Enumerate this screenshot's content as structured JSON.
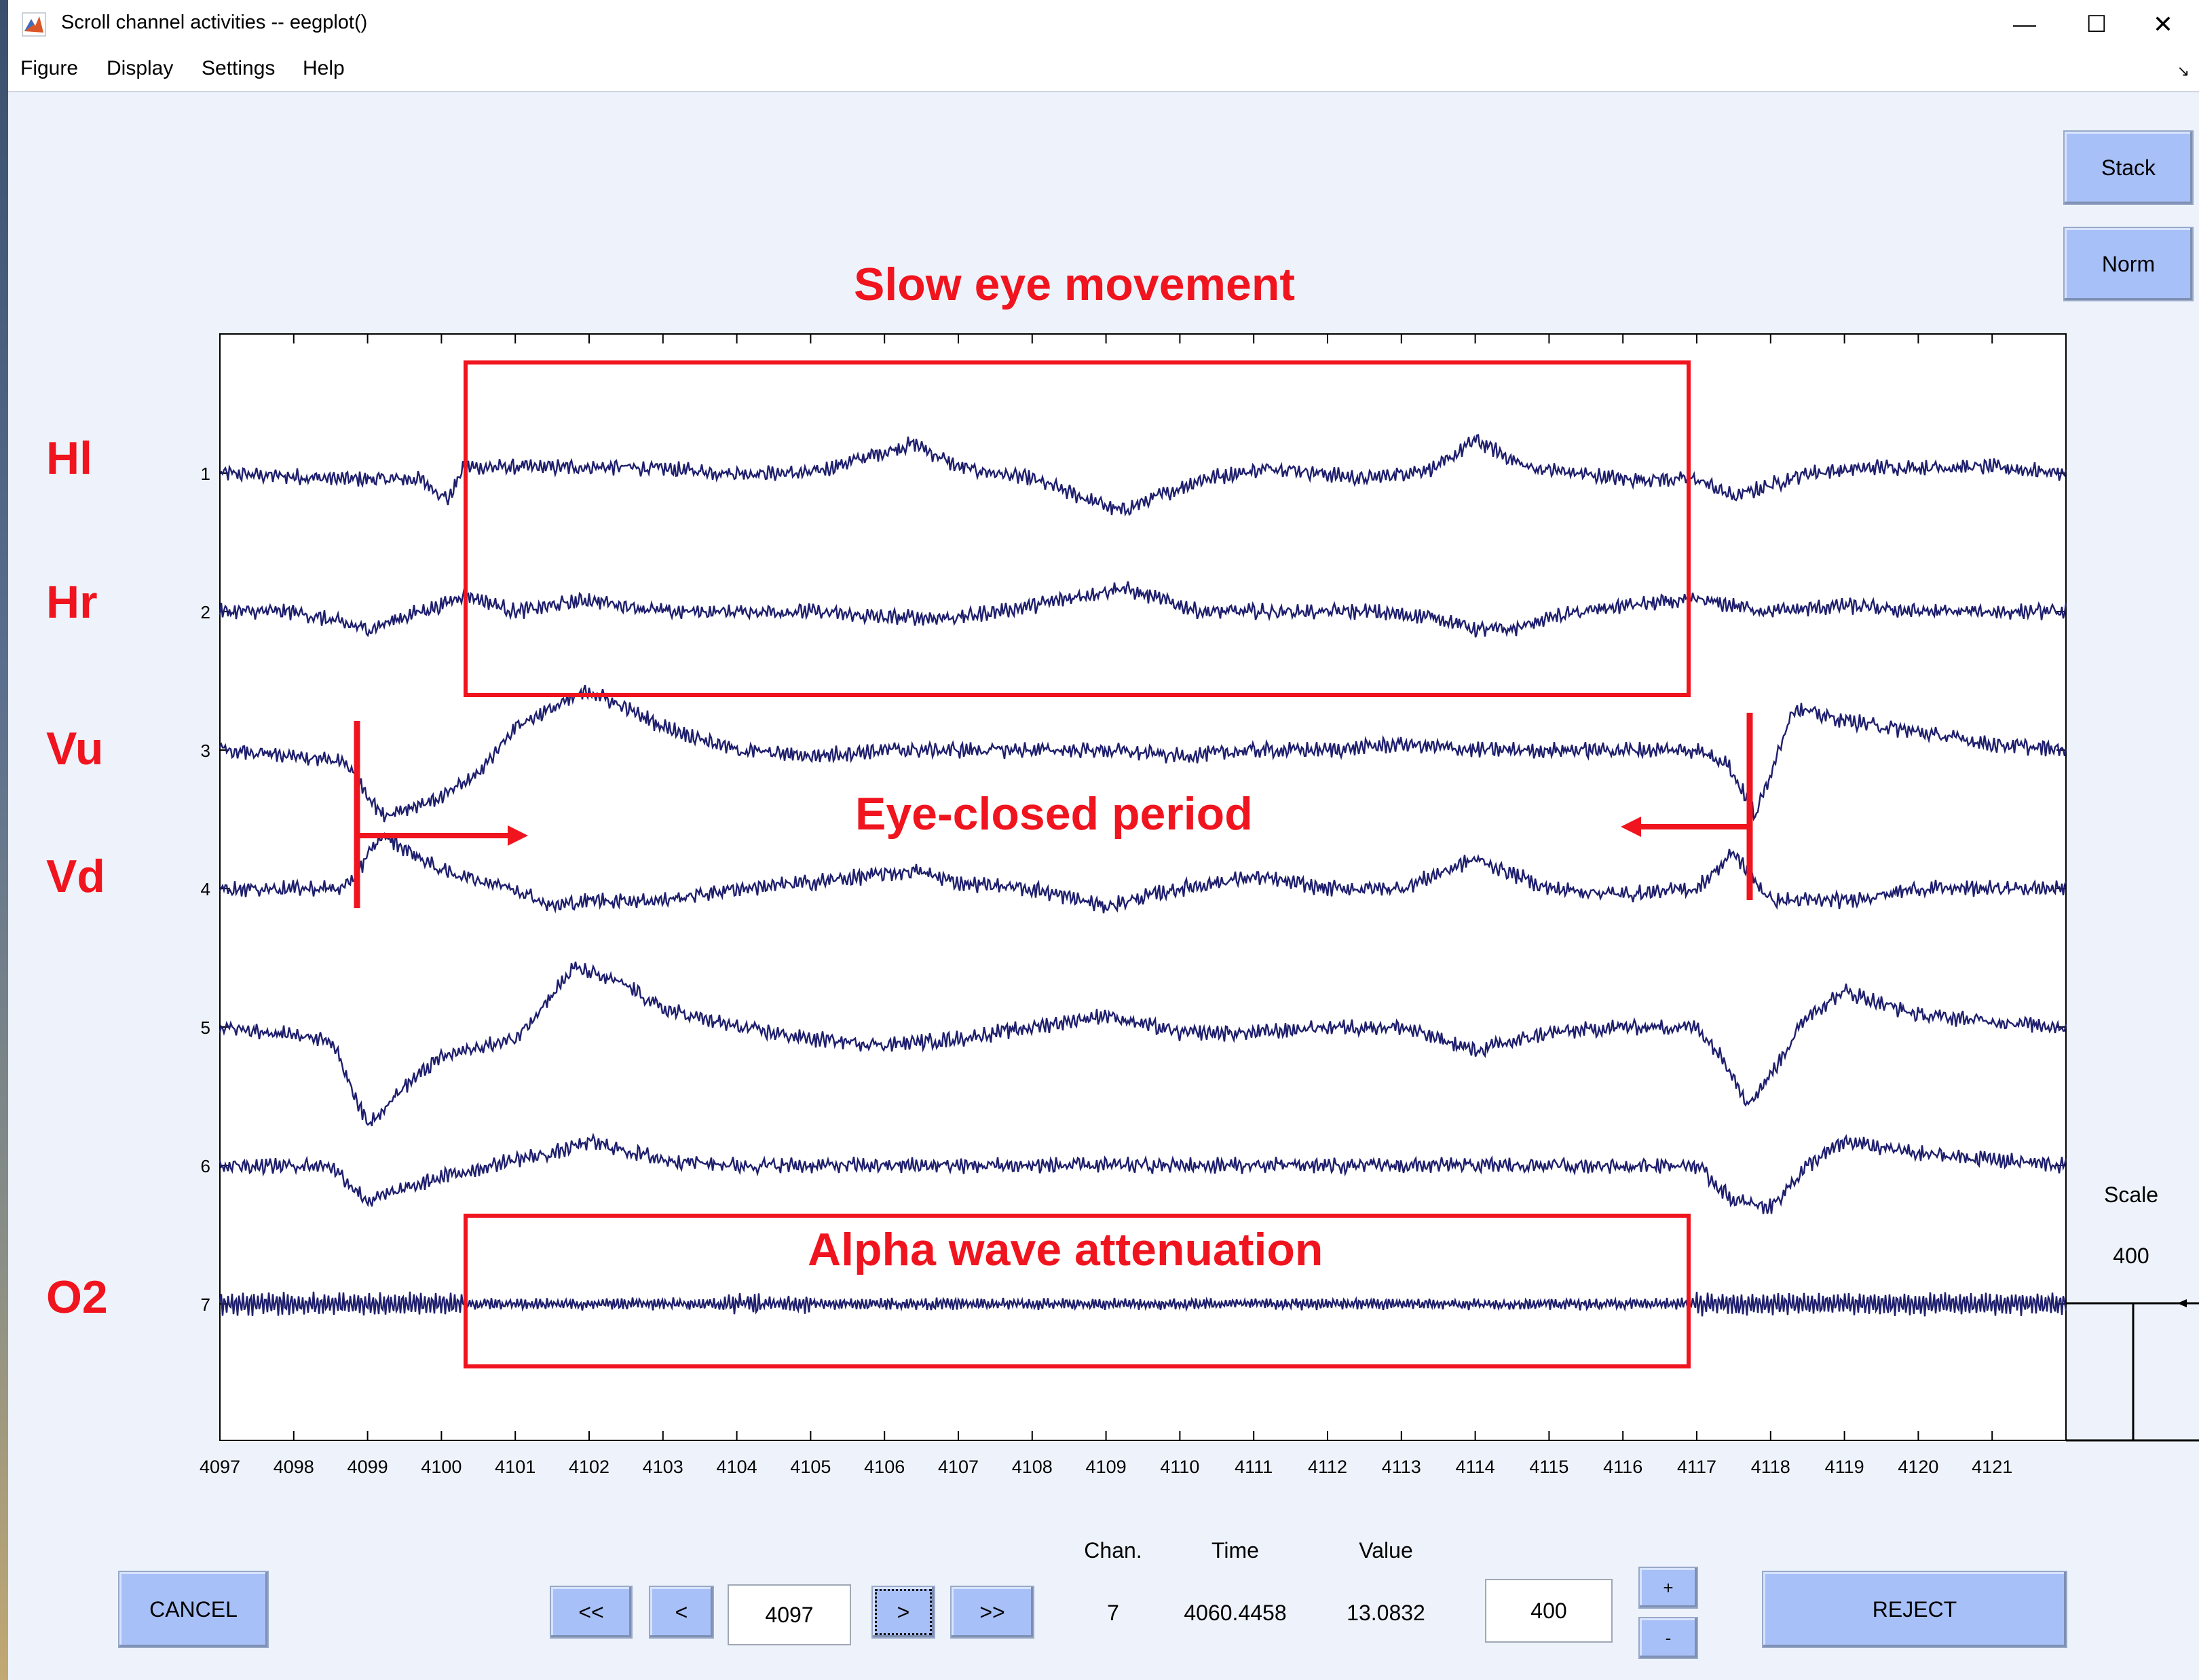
{
  "window": {
    "title": "Scroll channel activities -- eegplot()",
    "minimize": "—",
    "maximize": "☐",
    "close": "✕"
  },
  "menu": [
    "Figure",
    "Display",
    "Settings",
    "Help"
  ],
  "side_buttons": {
    "stack": "Stack",
    "norm": "Norm"
  },
  "annotations": {
    "slow": "Slow eye movement",
    "closed": "Eye-closed period",
    "alpha": "Alpha wave attenuation"
  },
  "channel_labels": [
    "Hl",
    "Hr",
    "Vu",
    "Vd",
    "O2"
  ],
  "scale": {
    "label": "Scale",
    "value": "400"
  },
  "controls": {
    "cancel": "CANCEL",
    "first": "<<",
    "prev": "<",
    "window_start": "4097",
    "next": ">",
    "last": ">>",
    "chan_label": "Chan.",
    "time_label": "Time",
    "value_label": "Value",
    "chan_value": "7",
    "time_value": "4060.4458",
    "value_value": "13.0832",
    "scale_box": "400",
    "plus": "+",
    "minus": "-",
    "reject": "REJECT"
  },
  "chart_data": {
    "type": "line",
    "x_ticks": [
      4097,
      4098,
      4099,
      4100,
      4101,
      4102,
      4103,
      4104,
      4105,
      4106,
      4107,
      4108,
      4109,
      4110,
      4111,
      4112,
      4113,
      4114,
      4115,
      4116,
      4117,
      4118,
      4119,
      4120,
      4121
    ],
    "xlim": [
      4097,
      4122
    ],
    "y_ticks": [
      "1",
      "2",
      "3",
      "4",
      "5",
      "6",
      "7"
    ],
    "line_color": "#1f1f6e",
    "series": [
      {
        "name": "1",
        "x": [
          4097,
          4098.7,
          4099.7,
          4100.1,
          4100.3,
          4101,
          4102.5,
          4104,
          4105,
          4106.4,
          4107,
          4108,
          4109.2,
          4110.3,
          4111.3,
          4112.5,
          4113.5,
          4114,
          4114.7,
          4116,
          4117,
          4117.5,
          4118.5,
          4119.5,
          4121,
          4122
        ],
        "y": [
          0,
          -0.05,
          -0.05,
          -0.22,
          0.05,
          0.05,
          0.05,
          0,
          0,
          0.25,
          0.05,
          -0.05,
          -0.32,
          -0.05,
          0.05,
          -0.05,
          0.05,
          0.28,
          0.05,
          -0.05,
          -0.05,
          -0.2,
          0,
          0.05,
          0.05,
          0
        ]
      },
      {
        "name": "2",
        "x": [
          4097,
          4098,
          4099,
          4099.7,
          4100,
          4100.3,
          4101,
          4102,
          4103,
          4104,
          4105,
          4106,
          4107,
          4108,
          4109.2,
          4110.3,
          4111,
          4112.5,
          4113.5,
          4114,
          4114.5,
          4115,
          4116,
          4117,
          4118,
          4119,
          4120,
          4121,
          4122
        ],
        "y": [
          0,
          0,
          -0.15,
          0,
          0.05,
          0.15,
          0,
          0.1,
          0,
          0,
          0,
          -0.05,
          -0.05,
          0.05,
          0.2,
          0,
          0,
          0,
          -0.05,
          -0.15,
          -0.15,
          -0.05,
          0.05,
          0.1,
          0,
          0.05,
          0,
          0,
          0
        ]
      },
      {
        "name": "3",
        "x": [
          4097,
          4098.7,
          4099.2,
          4100,
          4100.5,
          4101,
          4101.5,
          4102,
          4103,
          4104,
          4105,
          4106,
          4107,
          4108,
          4109,
          4110,
          4111,
          4112,
          4113,
          4114,
          4115,
          4116,
          4117,
          4117.4,
          4117.8,
          4118.3,
          4119,
          4120,
          4121,
          4122
        ],
        "y": [
          0,
          -0.1,
          -0.55,
          -0.4,
          -0.2,
          0.2,
          0.35,
          0.5,
          0.2,
          0,
          -0.05,
          0,
          0,
          0,
          0,
          -0.05,
          0,
          0,
          0.05,
          0,
          0,
          0,
          0,
          -0.1,
          -0.55,
          0.35,
          0.25,
          0.15,
          0.05,
          0
        ]
      },
      {
        "name": "4",
        "x": [
          4097,
          4098.7,
          4099.2,
          4100,
          4101,
          4101.5,
          4102,
          4103,
          4104,
          4105,
          4106.4,
          4107,
          4108,
          4109,
          4110,
          4111,
          4112,
          4113,
          4114,
          4115,
          4116,
          4117,
          4117.5,
          4118,
          4119,
          4120,
          4121,
          4122
        ],
        "y": [
          0,
          0,
          0.45,
          0.15,
          0,
          -0.15,
          -0.1,
          -0.1,
          0,
          0.05,
          0.15,
          0.05,
          0,
          -0.15,
          0,
          0.1,
          0,
          0,
          0.25,
          0,
          -0.05,
          0,
          0.3,
          -0.1,
          -0.1,
          0,
          0,
          0
        ]
      },
      {
        "name": "5",
        "x": [
          4097,
          4098.5,
          4099,
          4099.5,
          4100,
          4101,
          4101.4,
          4101.8,
          4102.5,
          4103,
          4104,
          4105,
          4106,
          4107,
          4108,
          4109,
          4110,
          4111,
          4112,
          4113,
          4114,
          4115,
          4116,
          4117,
          4117.4,
          4117.7,
          4118,
          4118.5,
          4119,
          4120,
          4121,
          4122
        ],
        "y": [
          0,
          -0.1,
          -0.82,
          -0.5,
          -0.25,
          -0.1,
          0.2,
          0.5,
          0.35,
          0.15,
          0,
          -0.1,
          -0.15,
          -0.1,
          0,
          0.1,
          -0.05,
          -0.05,
          0,
          0,
          -0.2,
          -0.05,
          0,
          0,
          -0.3,
          -0.65,
          -0.4,
          0.1,
          0.3,
          0.1,
          0.05,
          0
        ]
      },
      {
        "name": "6",
        "x": [
          4097,
          4098.5,
          4099,
          4100,
          4101,
          4101.5,
          4102,
          4103,
          4104,
          4105,
          4106,
          4107,
          4108,
          4109,
          4110,
          4111,
          4112,
          4113,
          4114,
          4115,
          4116,
          4117,
          4117.5,
          4118,
          4118.5,
          4119,
          4120,
          4121,
          4122
        ],
        "y": [
          0,
          0,
          -0.3,
          -0.1,
          0.05,
          0.1,
          0.2,
          0.05,
          0,
          0,
          0,
          0,
          0,
          0,
          0,
          0,
          0,
          0,
          0,
          0,
          0,
          0,
          -0.3,
          -0.35,
          0,
          0.2,
          0.1,
          0.05,
          0
        ]
      },
      {
        "name": "7",
        "x": [
          4097,
          4098,
          4099,
          4100,
          4101,
          4102,
          4103,
          4104,
          4105,
          4106,
          4107,
          4108,
          4109,
          4110,
          4111,
          4112,
          4113,
          4114,
          4115,
          4116,
          4117,
          4118,
          4119,
          4120,
          4121,
          4122
        ],
        "y": [
          0,
          0,
          0,
          0,
          0,
          0,
          0,
          0,
          0,
          0,
          0,
          0,
          0,
          0,
          0,
          0,
          0,
          0,
          0,
          0,
          0,
          0,
          0,
          0,
          0,
          0
        ]
      }
    ]
  }
}
